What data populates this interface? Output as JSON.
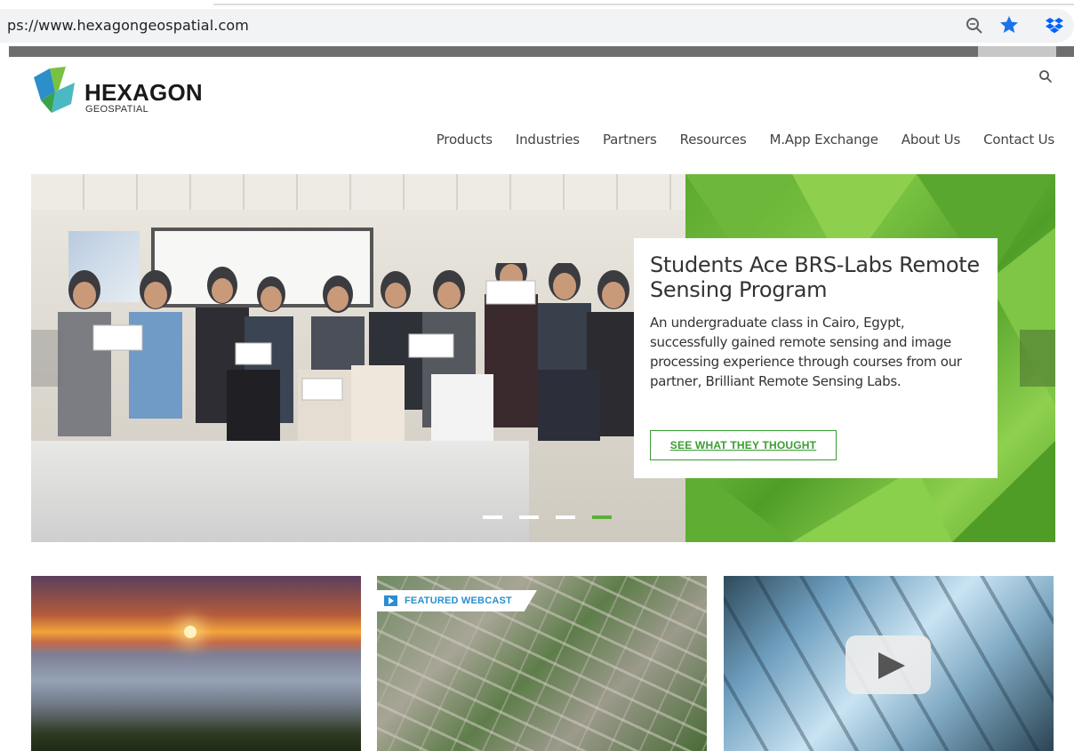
{
  "browser": {
    "url": "ps://www.hexagongeospatial.com"
  },
  "header": {
    "logo_word": "HEXAGON",
    "logo_sub": "GEOSPATIAL"
  },
  "nav": {
    "items": [
      "Products",
      "Industries",
      "Partners",
      "Resources",
      "M.App Exchange",
      "About Us",
      "Contact Us"
    ]
  },
  "hero": {
    "title": "Students Ace BRS-Labs Remote Sensing Program",
    "text": "An undergraduate class in Cairo, Egypt, successfully gained remote sensing and image processing experience through courses from our partner, Brilliant Remote Sensing Labs.",
    "button_label": "SEE WHAT THEY THOUGHT",
    "slide_count": 4,
    "active_slide": 4
  },
  "cards": {
    "webcast_label": "FEATURED WEBCAST"
  },
  "colors": {
    "accent_green": "#3c9c32",
    "webcast_blue": "#2a8fd0",
    "star_blue": "#1a73e8",
    "dropbox_blue": "#0061fe"
  }
}
